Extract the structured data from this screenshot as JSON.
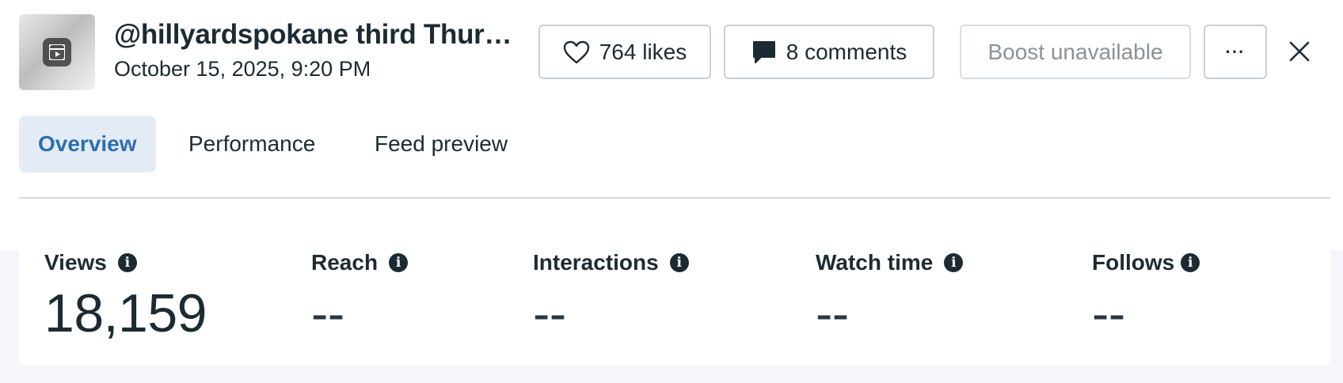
{
  "post": {
    "title": "@hillyardspokane third Thur…",
    "date": "October 15, 2025, 9:20 PM"
  },
  "actions": {
    "likes_label": "764 likes",
    "comments_label": "8 comments",
    "boost_label": "Boost unavailable",
    "more_label": "···"
  },
  "tabs": [
    {
      "label": "Overview",
      "active": true
    },
    {
      "label": "Performance",
      "active": false
    },
    {
      "label": "Feed preview",
      "active": false
    }
  ],
  "metrics": [
    {
      "label": "Views",
      "value": "18,159"
    },
    {
      "label": "Reach",
      "value": "--"
    },
    {
      "label": "Interactions",
      "value": "--"
    },
    {
      "label": "Watch time",
      "value": "--"
    },
    {
      "label": "Follows",
      "value": "--"
    }
  ],
  "icons": {
    "thumbnail": "reel-play-icon",
    "likes": "heart-icon",
    "comments": "speech-bubble-icon",
    "more": "more-dots-icon",
    "close": "close-icon",
    "info": "info-icon"
  },
  "colors": {
    "active_tab_bg": "#e3ecf4",
    "active_tab_text": "#2d6db5",
    "text": "#1c2b33",
    "disabled_text": "#8a9299"
  }
}
